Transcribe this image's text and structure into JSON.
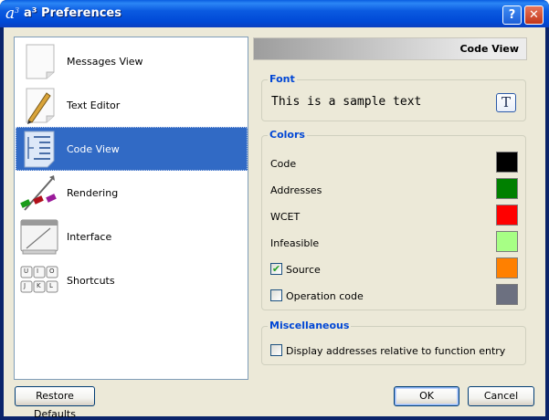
{
  "window": {
    "title": "a³ Preferences",
    "app_icon_glyph": "a",
    "app_icon_sup": "3",
    "help_glyph": "?",
    "close_glyph": "✕"
  },
  "nav": {
    "items": [
      {
        "label": "Messages View",
        "icon": "messages-view-icon"
      },
      {
        "label": "Text Editor",
        "icon": "text-editor-icon"
      },
      {
        "label": "Code View",
        "icon": "code-view-icon",
        "selected": true
      },
      {
        "label": "Rendering",
        "icon": "rendering-icon"
      },
      {
        "label": "Interface",
        "icon": "interface-icon"
      },
      {
        "label": "Shortcuts",
        "icon": "shortcuts-icon"
      }
    ],
    "shortcut_keys": [
      "U",
      "I",
      "O",
      "J",
      "K",
      "L"
    ]
  },
  "panel": {
    "header": "Code View",
    "font": {
      "title": "Font",
      "sample": "This is a sample text",
      "button_glyph": "T"
    },
    "colors": {
      "title": "Colors",
      "rows": [
        {
          "label": "Code",
          "color": "#000000"
        },
        {
          "label": "Addresses",
          "color": "#008000"
        },
        {
          "label": "WCET",
          "color": "#ff0000"
        },
        {
          "label": "Infeasible",
          "color": "#a7ff85"
        },
        {
          "label": "Source",
          "color": "#ff8000",
          "checkbox": true,
          "checked": true
        },
        {
          "label": "Operation code",
          "color": "#6c7080",
          "checkbox": true,
          "checked": false
        }
      ]
    },
    "misc": {
      "title": "Miscellaneous",
      "option": {
        "label": "Display addresses relative to function entry",
        "checked": false
      }
    }
  },
  "buttons": {
    "restore": "Restore Defaults",
    "ok": "OK",
    "cancel": "Cancel"
  },
  "check_glyph": "✔",
  "accent": "#316ac5"
}
